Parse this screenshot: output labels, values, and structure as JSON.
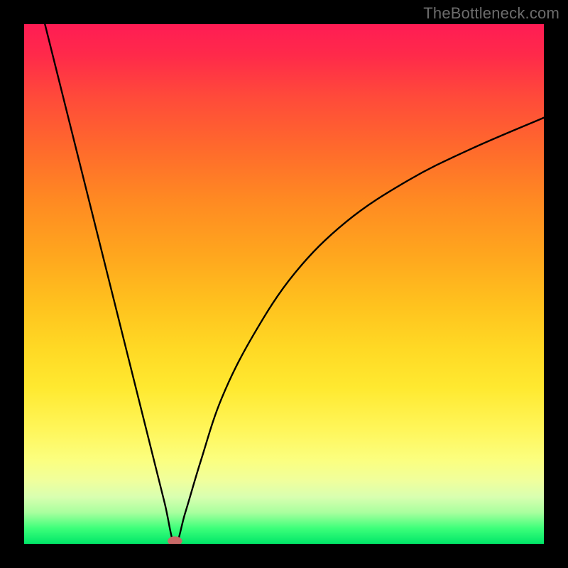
{
  "watermark": {
    "text": "TheBottleneck.com"
  },
  "colors": {
    "background": "#000000",
    "curve": "#000000",
    "marker": "#c96a68",
    "gradient_top": "#ff1c54",
    "gradient_bottom": "#00e668"
  },
  "chart_data": {
    "type": "line",
    "title": "",
    "xlabel": "",
    "ylabel": "",
    "xlim": [
      0,
      100
    ],
    "ylim": [
      0,
      100
    ],
    "grid": false,
    "legend": false,
    "notes": "V-shaped bottleneck curve; y is bottleneck percentage (0 at green bottom, 100 at red top). Single minimum near x≈29 where y≈0. Left branch descends steeply and nearly linearly from top-left; right branch rises with diminishing slope toward upper-right.",
    "series": [
      {
        "name": "bottleneck-curve",
        "x": [
          4,
          8,
          12,
          16,
          20,
          24,
          27,
          29,
          31,
          34,
          38,
          44,
          52,
          62,
          74,
          86,
          100
        ],
        "y": [
          100,
          84,
          68,
          52,
          36,
          20,
          8,
          0,
          6,
          16,
          28,
          40,
          52,
          62,
          70,
          76,
          82
        ]
      }
    ],
    "marker": {
      "x": 29,
      "y": 0,
      "rx": 1.4,
      "ry": 0.9
    }
  }
}
